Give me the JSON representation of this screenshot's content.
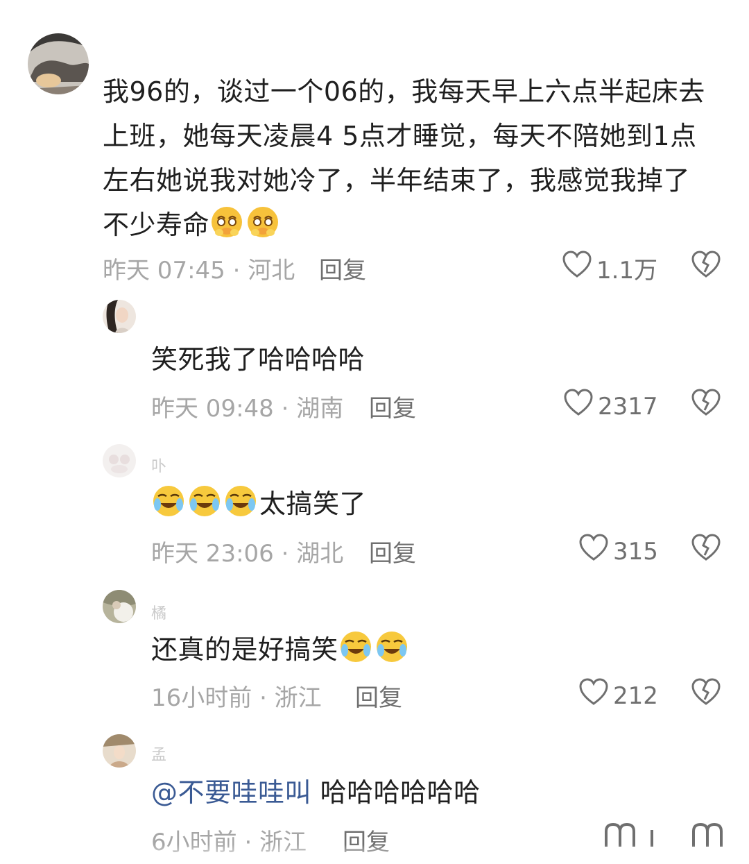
{
  "comments": [
    {
      "text": "我96的，谈过一个06的，我每天早上六点半起床去上班，她每天凌晨4 5点才睡觉，每天不陪她到1点左右她说我对她冷了，半年结束了，我感觉我掉了不少寿命",
      "emoji_suffix": [
        "holding-back-tears-emoji",
        "holding-back-tears-emoji"
      ],
      "time_loc": "昨天 07:45 · 河北",
      "reply_label": "回复",
      "likes": "1.1万"
    },
    {
      "username": "",
      "text": "笑死我了哈哈哈哈",
      "time_loc": "昨天 09:48 · 湖南",
      "reply_label": "回复",
      "likes": "2317"
    },
    {
      "username": "卟",
      "emoji_prefix": [
        "crying-laughing-emoji",
        "crying-laughing-emoji",
        "crying-laughing-emoji"
      ],
      "text": "太搞笑了",
      "time_loc": "昨天 23:06 · 湖北",
      "reply_label": "回复",
      "likes": "315"
    },
    {
      "username": "橘",
      "text": "还真的是好搞笑",
      "emoji_suffix": [
        "crying-laughing-emoji",
        "crying-laughing-emoji"
      ],
      "time_loc": "16小时前 · 浙江",
      "reply_label": "回复",
      "likes": "212"
    },
    {
      "username": "孟",
      "mention": "@不要哇哇叫",
      "text": "哈哈哈哈哈哈",
      "time_loc": "6小时前 · 浙江",
      "reply_label": "回复"
    }
  ],
  "colors": {
    "text": "#1f1f1f",
    "meta": "#a6a6a6",
    "action": "#6f6f6f",
    "mention": "#3a5a94"
  }
}
